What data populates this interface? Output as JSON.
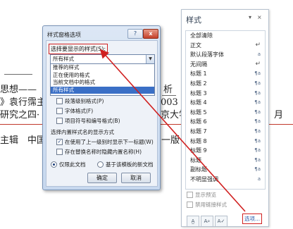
{
  "background_doc": {
    "line1_prefix": "思想——",
    "line1_suffix": "析",
    "line2_prefix": "》袁行霈主",
    "line2_mid": "003 年",
    "line3_prefix": "研究之四·",
    "line3_mid": "京大学",
    "line3_suffix": "月",
    "line4_prefix": "主辑　中国",
    "line4_suffix": "一版"
  },
  "dialog": {
    "title": "样式窗格选项",
    "help_label": "?",
    "close_label": "x",
    "select_label": "选择要显示的样式(S):",
    "dropdown_value": "所有样式",
    "dropdown_options": [
      "推荐的样式",
      "正在使用的格式",
      "当前文档中的格式",
      "所有样式"
    ],
    "format_options": [
      {
        "label": "段落级别格式(P)",
        "checked": false
      },
      {
        "label": "字体格式(F)",
        "checked": false
      },
      {
        "label": "项目符号和编号格式(B)",
        "checked": false
      }
    ],
    "builtin_label": "选择内置样式名的显示方式",
    "builtin_options": [
      {
        "label": "在使用了上一级别时显示下一标题(W)",
        "checked": true
      },
      {
        "label": "存在替换名称时隐藏内置名称(H)",
        "checked": false
      }
    ],
    "radio_options": [
      "仅限此文档",
      "基于该模板的新文档"
    ],
    "ok_label": "确定",
    "cancel_label": "取消"
  },
  "styles_pane": {
    "title": "样式",
    "ctrl_dropdown": "▾",
    "ctrl_close": "×",
    "items": [
      {
        "name": "全部清除",
        "mark": ""
      },
      {
        "name": "正文",
        "mark": "↵"
      },
      {
        "name": "默认段落字体",
        "mark": "a"
      },
      {
        "name": "无间隔",
        "mark": "↵"
      },
      {
        "name": "标题 1",
        "mark": "¶a"
      },
      {
        "name": "标题 2",
        "mark": "¶a"
      },
      {
        "name": "标题 3",
        "mark": "¶a"
      },
      {
        "name": "标题 4",
        "mark": "¶a"
      },
      {
        "name": "标题 5",
        "mark": "¶a"
      },
      {
        "name": "标题 6",
        "mark": "¶a"
      },
      {
        "name": "标题 7",
        "mark": "¶a"
      },
      {
        "name": "标题 8",
        "mark": "¶a"
      },
      {
        "name": "标题 9",
        "mark": "¶a"
      },
      {
        "name": "标题",
        "mark": "¶a"
      },
      {
        "name": "副标题",
        "mark": "¶a"
      },
      {
        "name": "不明显强调",
        "mark": "a"
      }
    ],
    "show_preview": "显示预览",
    "disable_linked": "禁用链接样式",
    "options_link": "选项...",
    "tool_icons": [
      "new-style-icon",
      "style-inspector-icon",
      "manage-styles-icon"
    ]
  },
  "colors": {
    "annotation_red": "#d02020",
    "selection_blue": "#3a6fc6",
    "dialog_bg": "#dce7f5"
  }
}
